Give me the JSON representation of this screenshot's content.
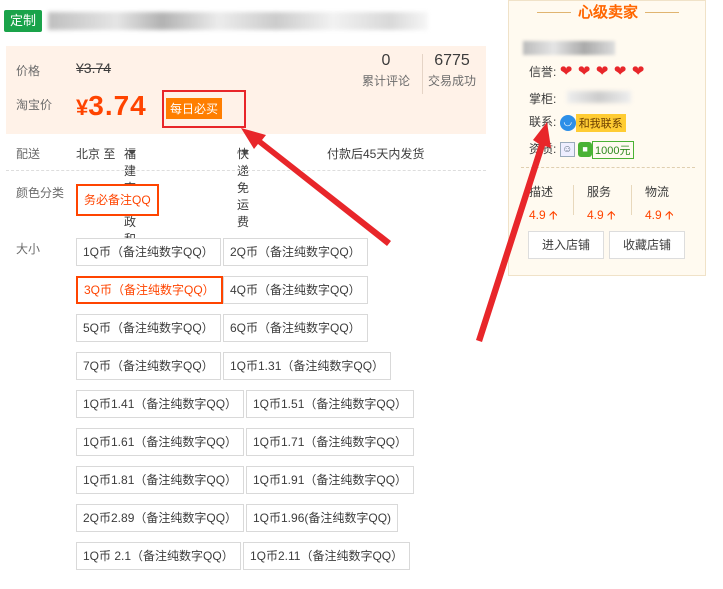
{
  "header": {
    "custom_tag": "定制"
  },
  "price": {
    "label_price": "价格",
    "old_price": "¥3.74",
    "label_taobao_price": "淘宝价",
    "currency": "¥",
    "new_price": "3.74",
    "daily_badge": "每日必买",
    "reviews_count": "0",
    "reviews_label": "累计评论",
    "deals_count": "6775",
    "deals_label": "交易成功"
  },
  "delivery": {
    "label": "配送",
    "from": "北京 至",
    "to": "福建南平政和县",
    "shipping": "快递免运费",
    "ship_time": "付款后45天内发货"
  },
  "color": {
    "label": "颜色分类",
    "options": [
      "务必备注QQ"
    ],
    "selected": "务必备注QQ"
  },
  "size": {
    "label": "大小",
    "options": [
      "1Q币（备注纯数字QQ）",
      "2Q币（备注纯数字QQ）",
      "3Q币（备注纯数字QQ）",
      "4Q币（备注纯数字QQ）",
      "5Q币（备注纯数字QQ）",
      "6Q币（备注纯数字QQ）",
      "7Q币（备注纯数字QQ）",
      "1Q币1.31（备注纯数字QQ）",
      "1Q币1.41（备注纯数字QQ）",
      "1Q币1.51（备注纯数字QQ）",
      "1Q币1.61（备注纯数字QQ）",
      "1Q币1.71（备注纯数字QQ）",
      "1Q币1.81（备注纯数字QQ）",
      "1Q币1.91（备注纯数字QQ）",
      "2Q币2.89（备注纯数字QQ）",
      "1Q币1.96(备注纯数字QQ)",
      "1Q币 2.1（备注纯数字QQ）",
      "1Q币2.11（备注纯数字QQ）"
    ],
    "selected": "3Q币（备注纯数字QQ）"
  },
  "seller": {
    "title": "心级卖家",
    "credit_label": "信誉:",
    "credit_hearts": 5,
    "keeper_label": "掌柜:",
    "contact_label": "联系:",
    "contact_button": "和我联系",
    "qualification_label": "资质:",
    "deposit": "1000元",
    "scores": [
      {
        "name": "描述",
        "value": "4.9"
      },
      {
        "name": "服务",
        "value": "4.9"
      },
      {
        "name": "物流",
        "value": "4.9"
      }
    ],
    "enter_shop": "进入店铺",
    "favorite_shop": "收藏店铺"
  },
  "colors": {
    "accent": "#ff4400",
    "badge": "#ff7e00",
    "highlight": "#e8262a",
    "custom_tag": "#1aa34a"
  }
}
